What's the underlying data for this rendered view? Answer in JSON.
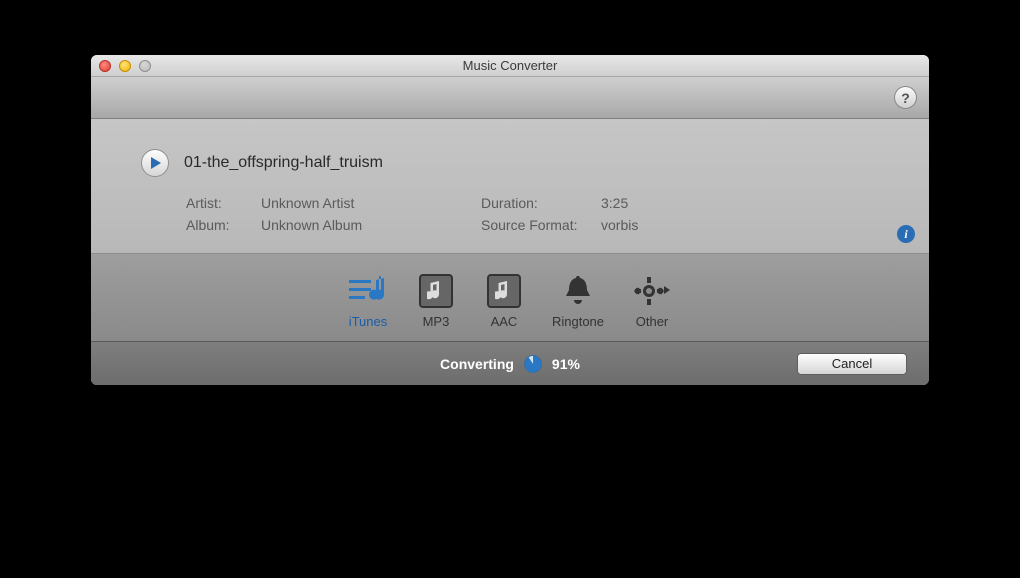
{
  "window": {
    "title": "Music Converter"
  },
  "file": {
    "name": "01-the_offspring-half_truism",
    "artist_label": "Artist:",
    "artist": "Unknown Artist",
    "album_label": "Album:",
    "album": "Unknown Album",
    "duration_label": "Duration:",
    "duration": "3:25",
    "format_label": "Source Format:",
    "format": "vorbis"
  },
  "formats": {
    "itunes": "iTunes",
    "mp3": "MP3",
    "aac": "AAC",
    "ringtone": "Ringtone",
    "other": "Other"
  },
  "status": {
    "label": "Converting",
    "percent": "91%",
    "cancel": "Cancel"
  },
  "help_glyph": "?",
  "info_glyph": "i"
}
